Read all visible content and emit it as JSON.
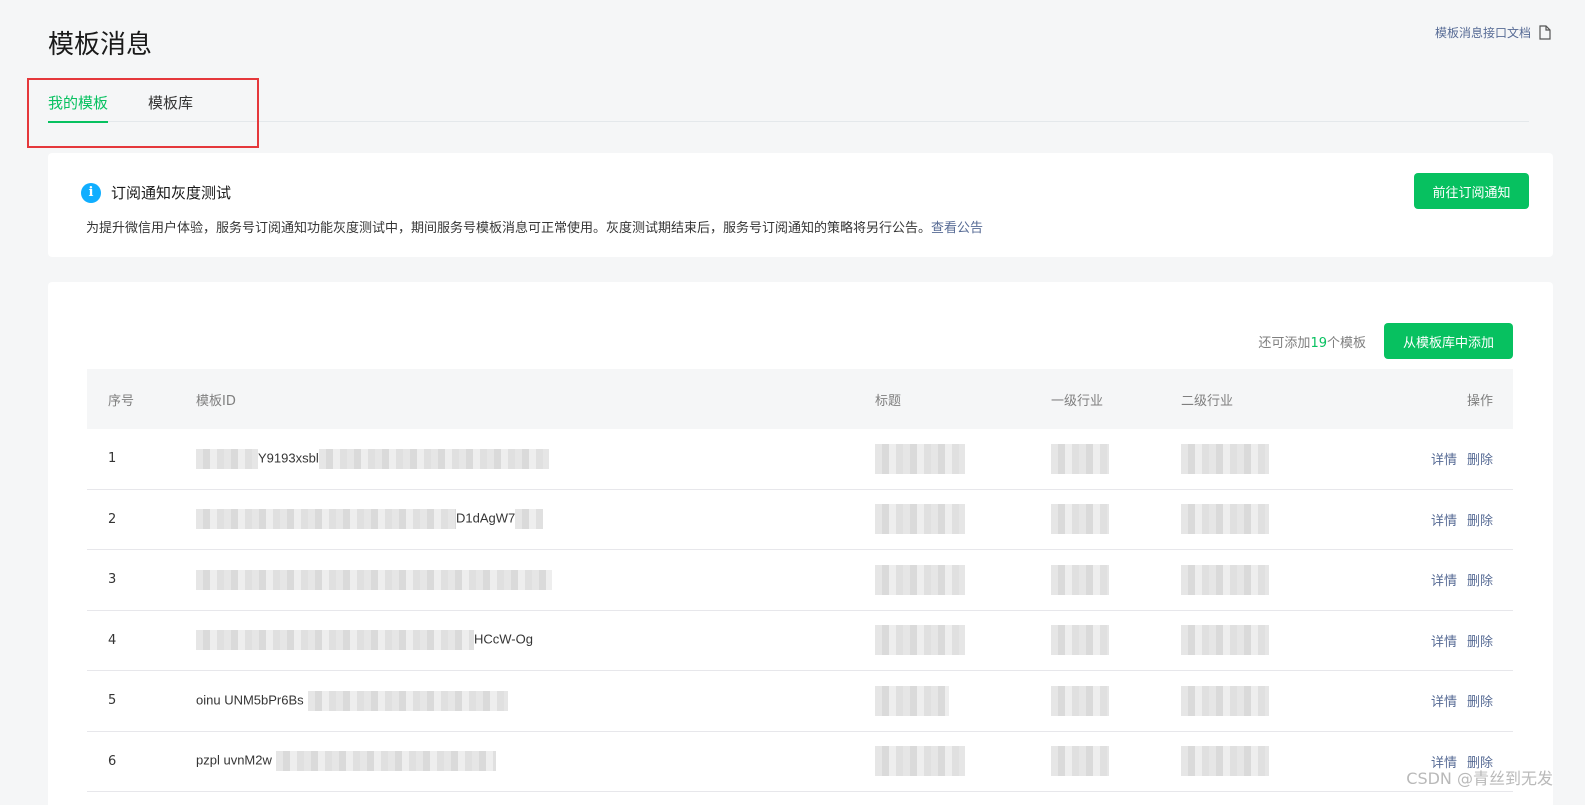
{
  "page": {
    "title": "模板消息",
    "doc_link": "模板消息接口文档"
  },
  "tabs": [
    {
      "label": "我的模板",
      "active": true
    },
    {
      "label": "模板库",
      "active": false
    }
  ],
  "notice": {
    "title": "订阅通知灰度测试",
    "description": "为提升微信用户体验，服务号订阅通知功能灰度测试中，期间服务号模板消息可正常使用。灰度测试期结束后，服务号订阅通知的策略将另行公告。",
    "link_label": "查看公告",
    "button_label": "前往订阅通知"
  },
  "templates": {
    "quota_prefix": "还可添加",
    "quota_count": "19",
    "quota_suffix": "个模板",
    "add_button": "从模板库中添加",
    "columns": [
      "序号",
      "模板ID",
      "标题",
      "一级行业",
      "二级行业",
      "操作"
    ],
    "rows": [
      {
        "index": "1",
        "id_visible": "Y9193xsbl"
      },
      {
        "index": "2",
        "id_visible": "D1dAgW7"
      },
      {
        "index": "3",
        "id_visible": ""
      },
      {
        "index": "4",
        "id_visible": "HCcW-Og"
      },
      {
        "index": "5",
        "id_visible": "oinu UNM5bPr6Bs"
      },
      {
        "index": "6",
        "id_visible": "pzpl uvnM2w"
      }
    ],
    "action_detail": "详情",
    "action_delete": "删除"
  },
  "watermark": "CSDN @青丝到无发",
  "colors": {
    "accent": "#07c160",
    "link": "#576b95",
    "info": "#10aeff",
    "highlight": "#e5383b"
  }
}
